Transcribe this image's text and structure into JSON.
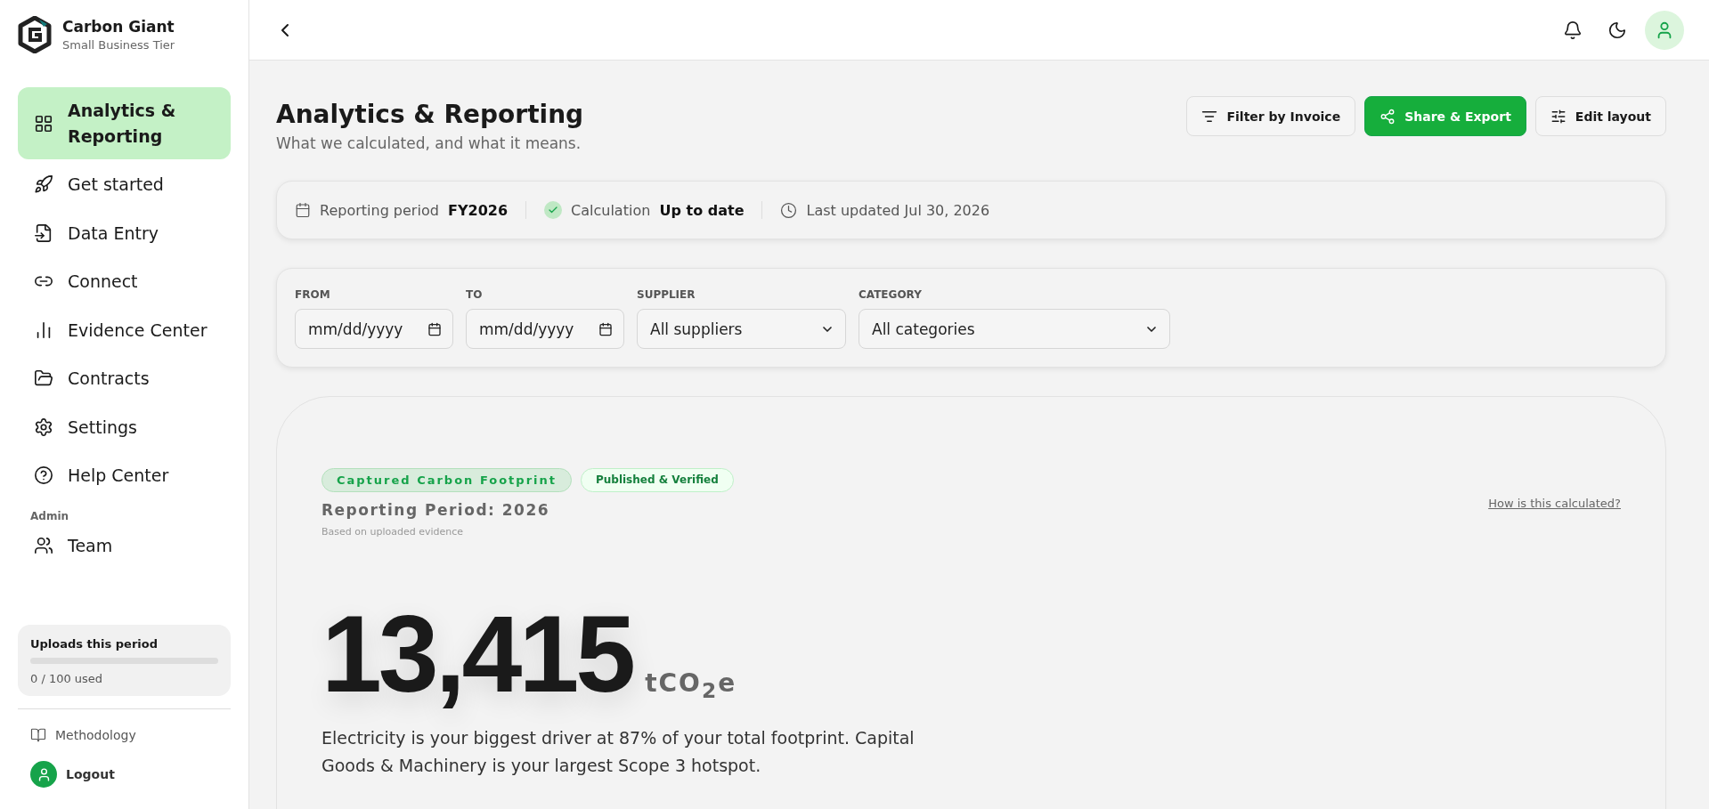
{
  "brand": {
    "name": "Carbon Giant",
    "tier": "Small Business Tier"
  },
  "sidebar": {
    "items": [
      {
        "label": "Analytics & Reporting",
        "selected": true
      },
      {
        "label": "Get started",
        "selected": false
      },
      {
        "label": "Data Entry",
        "selected": false
      },
      {
        "label": "Connect",
        "selected": false
      },
      {
        "label": "Evidence Center",
        "selected": false
      },
      {
        "label": "Contracts",
        "selected": false
      },
      {
        "label": "Settings",
        "selected": false
      },
      {
        "label": "Help Center",
        "selected": false
      }
    ],
    "section": "Admin",
    "admin_items": [
      {
        "label": "Team",
        "selected": false
      }
    ],
    "uploads": {
      "title": "Uploads this period",
      "level": 0,
      "reading": "0 / 100 used"
    },
    "footer": {
      "methodology": "Methodology",
      "logout": "Logout"
    }
  },
  "page": {
    "title": "Analytics & Reporting",
    "subtitle": "What we calculated, and what it means.",
    "actions": [
      {
        "label": "Filter by Invoice",
        "kind": "filter",
        "primary": false
      },
      {
        "label": "Share & Export",
        "kind": "share",
        "primary": true
      },
      {
        "label": "Edit layout",
        "kind": "layout",
        "primary": false
      }
    ]
  },
  "status": {
    "period_label": "Reporting period",
    "period_value": "FY2026",
    "calc_label": "Calculation",
    "calc_value": "Up to date",
    "updated": "Last updated Jul 30, 2026"
  },
  "filters": [
    {
      "label": "FROM",
      "kind": "date",
      "placeholder": "mm/dd/yyyy"
    },
    {
      "label": "TO",
      "kind": "date",
      "placeholder": "mm/dd/yyyy"
    },
    {
      "label": "SUPPLIER",
      "kind": "select",
      "value": "All suppliers"
    },
    {
      "label": "CATEGORY",
      "kind": "select",
      "value": "All categories"
    }
  ],
  "footprint": {
    "badges": [
      {
        "label": "Captured Carbon Footprint",
        "kind": "main"
      },
      {
        "label": "Published & Verified",
        "kind": "verified"
      }
    ],
    "period": "Reporting Period: 2026",
    "basis": "Based on uploaded evidence",
    "link": "How is this calculated?",
    "value": "13,415",
    "unit": "tCO$_{2}$e",
    "summary": "Electricity is your biggest driver at 87% of your total footprint. Capital Goods & Machinery is your largest Scope 3 hotspot."
  }
}
